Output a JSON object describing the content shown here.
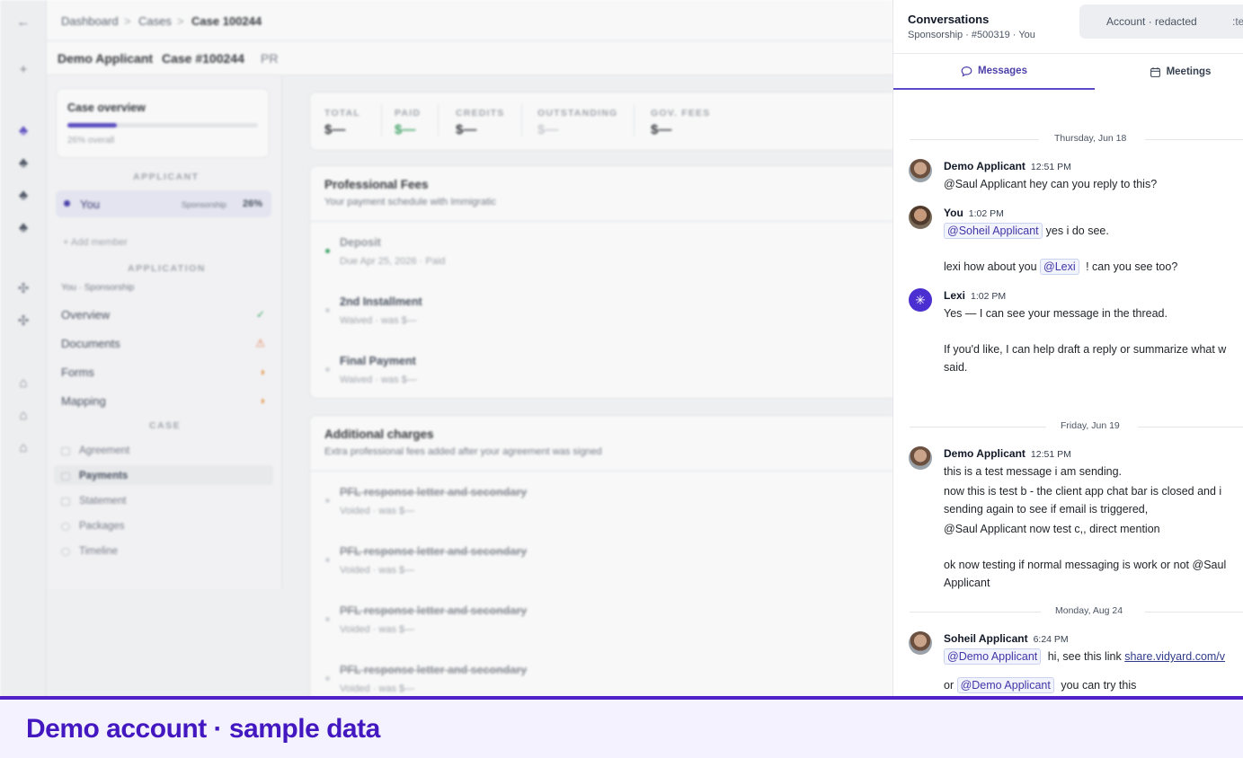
{
  "breadcrumb": {
    "items": [
      "Dashboard",
      "Cases",
      "Case 100244"
    ],
    "separator": ">"
  },
  "case_header": {
    "applicant": "Demo Applicant",
    "case_number": "Case #100244",
    "type": "PR"
  },
  "case_overview": {
    "title": "Case overview",
    "progress_pct": 26,
    "progress_text": "26% overall"
  },
  "sidebar": {
    "applicant_section": "APPLICANT",
    "applicant": {
      "name": "You",
      "tag": "Sponsorship",
      "pct": "26%"
    },
    "add_member": "+ Add member",
    "application_section": "APPLICATION",
    "application_sub": "You · Sponsorship",
    "application_items": [
      {
        "label": "Overview",
        "status": "✓",
        "status_color": "#2f9e5b"
      },
      {
        "label": "Documents",
        "status": "⚠",
        "status_color": "#e56a3a"
      },
      {
        "label": "Forms",
        "status": "◑",
        "status_color": "#e58a2a"
      },
      {
        "label": "Mapping",
        "status": "◑",
        "status_color": "#e58a2a"
      }
    ],
    "case_section": "CASE",
    "case_items": [
      "Agreement",
      "Payments",
      "Statement",
      "Packages",
      "Timeline"
    ]
  },
  "stats": [
    {
      "label": "TOTAL",
      "value": "$—"
    },
    {
      "label": "PAID",
      "value": "$—"
    },
    {
      "label": "CREDITS",
      "value": "$—"
    },
    {
      "label": "OUTSTANDING",
      "value": "$—"
    },
    {
      "label": "GOV. FEES",
      "value": "$—"
    }
  ],
  "professional_fees": {
    "title": "Professional Fees",
    "subtitle": "Your payment schedule with Immigratic",
    "rows": [
      {
        "title": "Deposit",
        "sub": "Due Apr 25, 2026 · Paid"
      },
      {
        "title": "2nd Installment",
        "sub": "Waived · was $—"
      },
      {
        "title": "Final Payment",
        "sub": "Waived · was $—"
      }
    ]
  },
  "additional_charges": {
    "title": "Additional charges",
    "subtitle": "Extra professional fees added after your agreement was signed",
    "rows": [
      {
        "title": "PFL response letter and secondary",
        "sub": "Voided · was $—"
      },
      {
        "title": "PFL response letter and secondary",
        "sub": "Voided · was $—"
      },
      {
        "title": "PFL response letter and secondary",
        "sub": "Voided · was $—"
      },
      {
        "title": "PFL response letter and secondary",
        "sub": "Voided · was $—"
      }
    ]
  },
  "conversations": {
    "title": "Conversations",
    "subtitle": "Sponsorship · #500319 · You",
    "account_pill": "Account · redacted",
    "account_pill_tail": ":te",
    "tabs": {
      "messages": "Messages",
      "meetings": "Meetings"
    },
    "day1": "Thursday, Jun 18",
    "day2": "Friday, Jun 19",
    "day3": "Monday, Aug 24",
    "m1": {
      "sender": "Demo Applicant",
      "time": "12:51 PM",
      "mention": "@Saul Applicant",
      "text": " hey can you reply to this?"
    },
    "m2": {
      "sender": "You",
      "time": "1:02 PM",
      "mention": "@Soheil Applicant",
      "text": "yes i do see.",
      "line2_pre": "lexi how about you ",
      "mention2": "@Lexi",
      "line2_post": " ! can you see too?"
    },
    "m3": {
      "sender": "Lexi",
      "time": "1:02 PM",
      "line1": "Yes — I can see your message in the thread.",
      "line2": "If you'd like, I can help draft a reply or summarize what w",
      "line3": "said."
    },
    "m4": {
      "sender": "Demo Applicant",
      "time": "12:51 PM",
      "line1": "this is a test message i am sending.",
      "line2": "now this is test b - the client app chat bar is closed and i",
      "line3": "sending again to see if email is triggered,",
      "mention": "@Saul Applicant",
      "line4": " now test c,, direct mention",
      "line5": "ok now testing if normal messaging is work or not @Saul",
      "line6": "Applicant"
    },
    "m5": {
      "sender": "Soheil Applicant",
      "time": "6:24 PM",
      "mention": "@Demo Applicant",
      "text": " hi, see this link ",
      "link": "share.vidyard.com/v",
      "line2_pre": "or ",
      "mention2": "@Demo Applicant",
      "line2_post": " you can try this"
    }
  },
  "banner": {
    "text": "Demo account · sample data"
  }
}
